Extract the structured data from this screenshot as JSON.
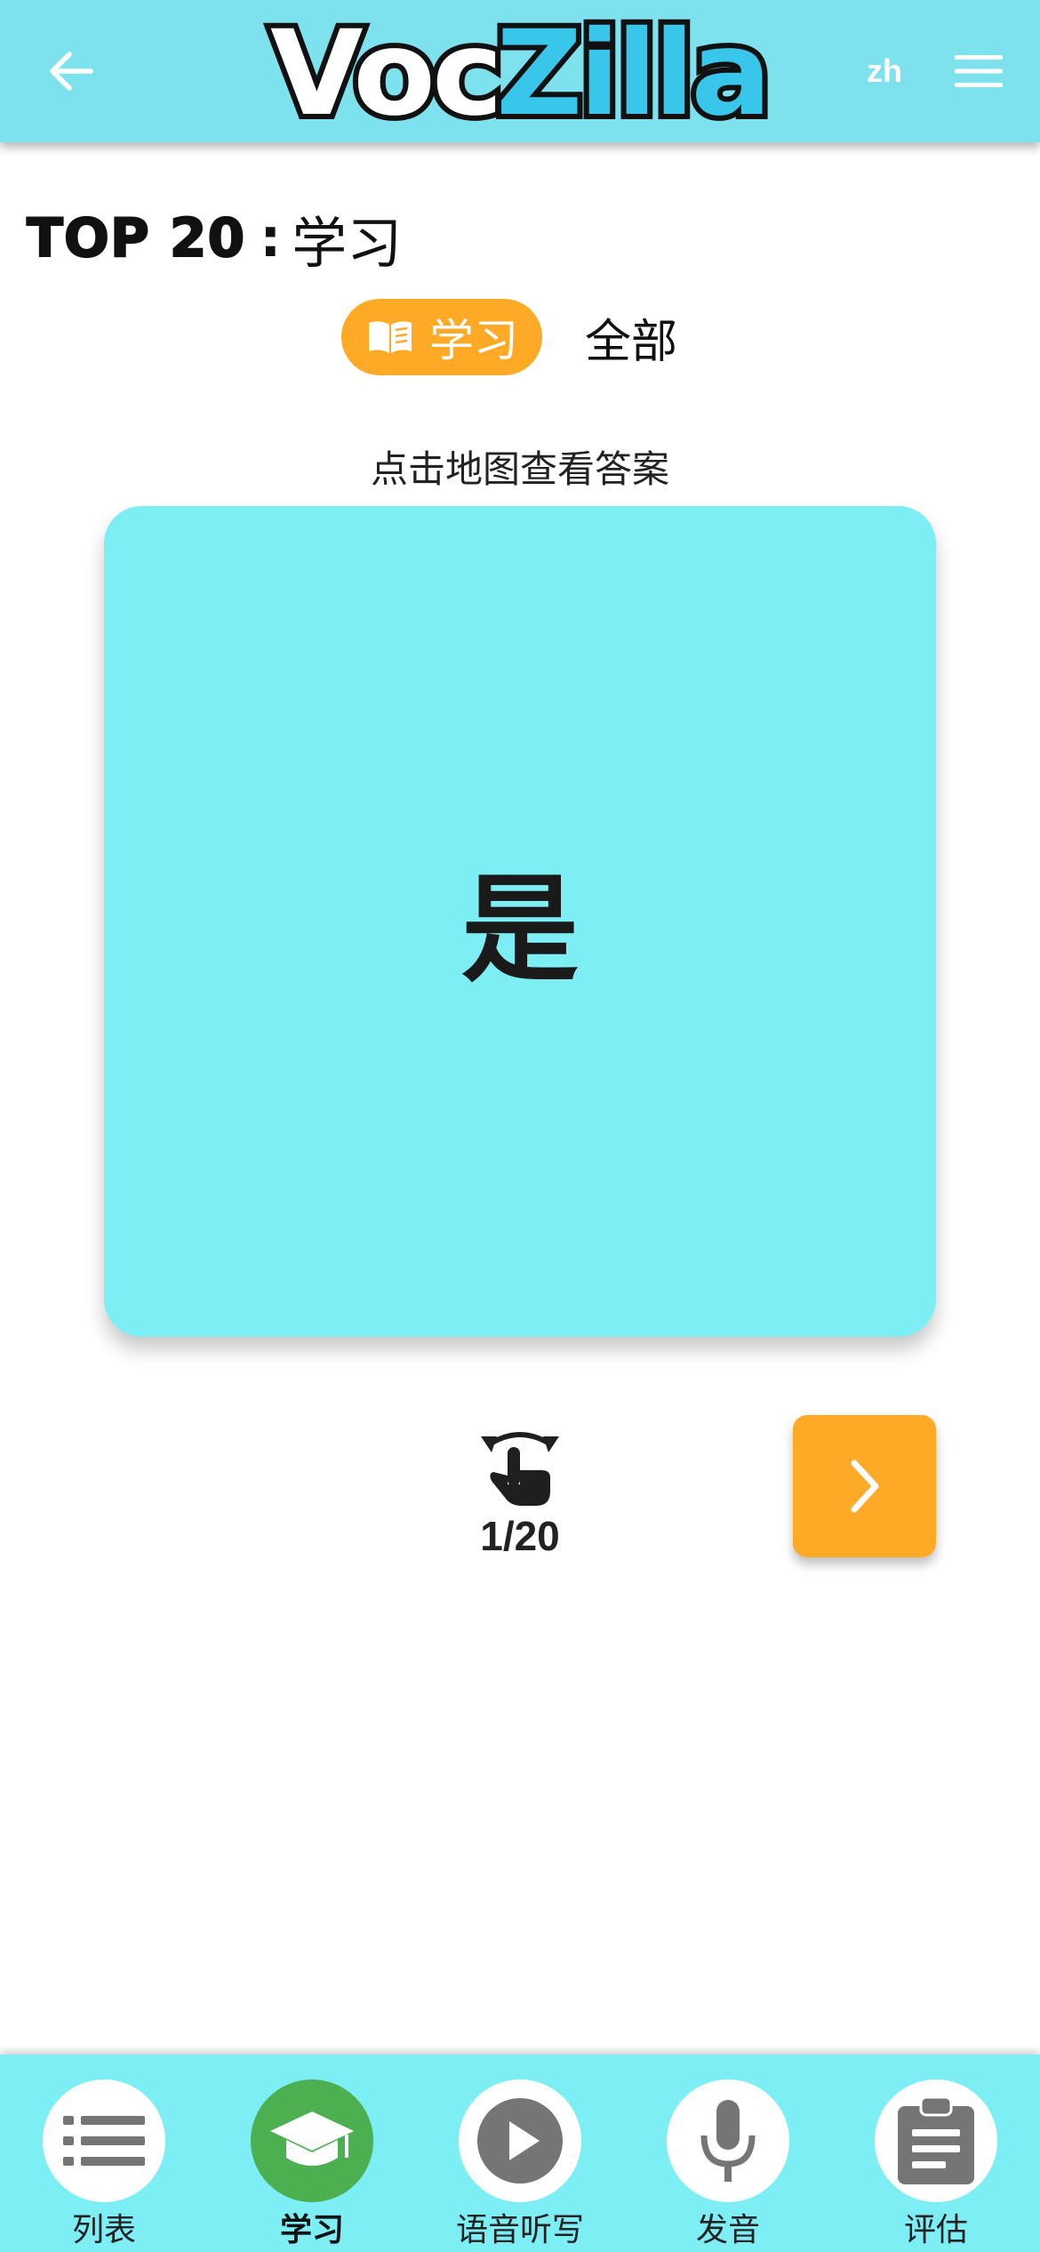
{
  "header": {
    "logo": {
      "part1": "Voc",
      "part2": "Zilla"
    },
    "language": "zh"
  },
  "title": {
    "prefix": "TOP 20",
    "separator": ":",
    "mode": "学习"
  },
  "tabs": {
    "learn": "学习",
    "all": "全部"
  },
  "hint": "点击地图查看答案",
  "card": {
    "word": "是"
  },
  "progress": {
    "current": 1,
    "total": 20,
    "label": "1/20"
  },
  "bottom_nav": [
    {
      "label": "列表",
      "icon": "list-icon",
      "active": false
    },
    {
      "label": "学习",
      "icon": "graduation-cap-icon",
      "active": true
    },
    {
      "label": "语音听写",
      "icon": "play-icon",
      "active": false
    },
    {
      "label": "发音",
      "icon": "microphone-icon",
      "active": false
    },
    {
      "label": "评估",
      "icon": "clipboard-icon",
      "active": false
    }
  ],
  "colors": {
    "header_bg": "#7ee1ee",
    "card_bg": "#7eeef5",
    "accent_orange": "#ffaa27",
    "active_green": "#4caf50",
    "logo_blue": "#38c6ea"
  }
}
